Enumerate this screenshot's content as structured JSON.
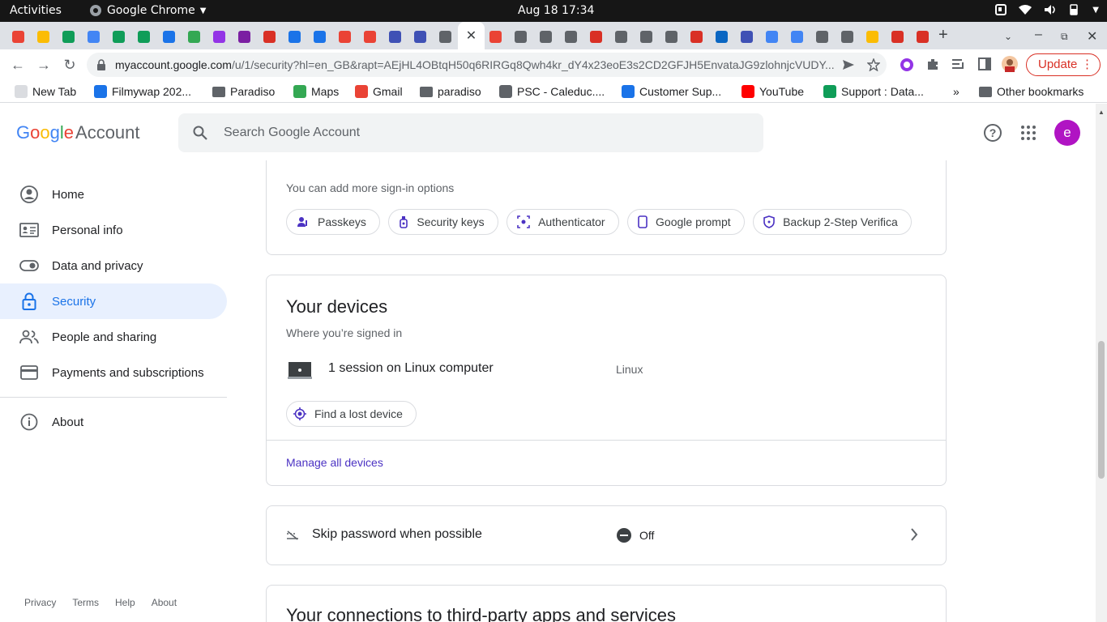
{
  "system_bar": {
    "activities": "Activities",
    "app_name": "Google Chrome",
    "clock": "Aug 18  17:34"
  },
  "browser": {
    "url_host": "myaccount.google.com",
    "url_path": "/u/1/security?hl=en_GB&rapt=AEjHL4OBtqH50q6RIRGq8Qwh4kr_dY4x23eoE3s2CD2GFJH5EnvataJG9zlohnjcVUDY...",
    "update_label": "Update",
    "bookmarks": [
      {
        "label": "New Tab",
        "icon": "new-tab-icon",
        "color": "#dadce0"
      },
      {
        "label": "Filmywap 202...",
        "icon": "filmywap-icon",
        "color": "#1a73e8"
      },
      {
        "label": "Paradiso",
        "icon": "folder-icon",
        "color": "#5f6368"
      },
      {
        "label": "Maps",
        "icon": "maps-icon",
        "color": "#34a853"
      },
      {
        "label": "Gmail",
        "icon": "gmail-icon",
        "color": "#ea4335"
      },
      {
        "label": "paradiso",
        "icon": "folder-icon",
        "color": "#5f6368"
      },
      {
        "label": "PSC - Caleduc....",
        "icon": "globe-icon",
        "color": "#5f6368"
      },
      {
        "label": "Customer Sup...",
        "icon": "drop-icon",
        "color": "#1a73e8"
      },
      {
        "label": "YouTube",
        "icon": "youtube-icon",
        "color": "#ff0000"
      },
      {
        "label": "Support : Data...",
        "icon": "support-icon",
        "color": "#0f9d58"
      }
    ],
    "bookmarks_more": "»",
    "other_bookmarks": "Other bookmarks",
    "tab_colors": [
      "#ea4335",
      "#fbbc04",
      "#0f9d58",
      "#4285f4",
      "#0f9d58",
      "#0f9d58",
      "#1a73e8",
      "#34a853",
      "#9334e6",
      "#7b1fa2",
      "#d93025",
      "#1a73e8",
      "#1a73e8",
      "#ea4335",
      "#ea4335",
      "#3f51b5",
      "#3f51b5",
      "#5f6368",
      "#ea4335",
      "#5f6368",
      "#5f6368",
      "#5f6368",
      "#d93025",
      "#5f6368",
      "#5f6368",
      "#5f6368",
      "#d93025",
      "#0a66c2",
      "#3f51b5",
      "#4285f4",
      "#4285f4",
      "#5f6368",
      "#5f6368",
      "#fbbc04",
      "#d93025",
      "#d93025"
    ]
  },
  "header": {
    "logo_google": "Google",
    "logo_account": "Account",
    "search_placeholder": "Search Google Account",
    "avatar_letter": "e"
  },
  "sidebar": {
    "items": [
      {
        "label": "Home",
        "icon": "home-icon"
      },
      {
        "label": "Personal info",
        "icon": "id-card-icon"
      },
      {
        "label": "Data and privacy",
        "icon": "toggle-icon"
      },
      {
        "label": "Security",
        "icon": "lock-icon"
      },
      {
        "label": "People and sharing",
        "icon": "people-icon"
      },
      {
        "label": "Payments and subscriptions",
        "icon": "credit-card-icon"
      }
    ],
    "about": "About",
    "footer": [
      "Privacy",
      "Terms",
      "Help",
      "About"
    ]
  },
  "signin_card": {
    "add_more": "You can add more sign-in options",
    "chips": [
      "Passkeys",
      "Security keys",
      "Authenticator",
      "Google prompt",
      "Backup 2-Step Verifica"
    ]
  },
  "devices_card": {
    "title": "Your devices",
    "subtitle": "Where you’re signed in",
    "session_text": "1 session on Linux computer",
    "session_os": "Linux",
    "find_button": "Find a lost device",
    "manage_link": "Manage all devices"
  },
  "skip_password": {
    "label": "Skip password when possible",
    "status": "Off"
  },
  "third_party_card": {
    "title": "Your connections to third-party apps and services"
  },
  "colors": {
    "accent": "#1a73e8",
    "selected_bg": "#e8f0fe",
    "avatar": "#b014c3",
    "link": "#4b32c3"
  }
}
